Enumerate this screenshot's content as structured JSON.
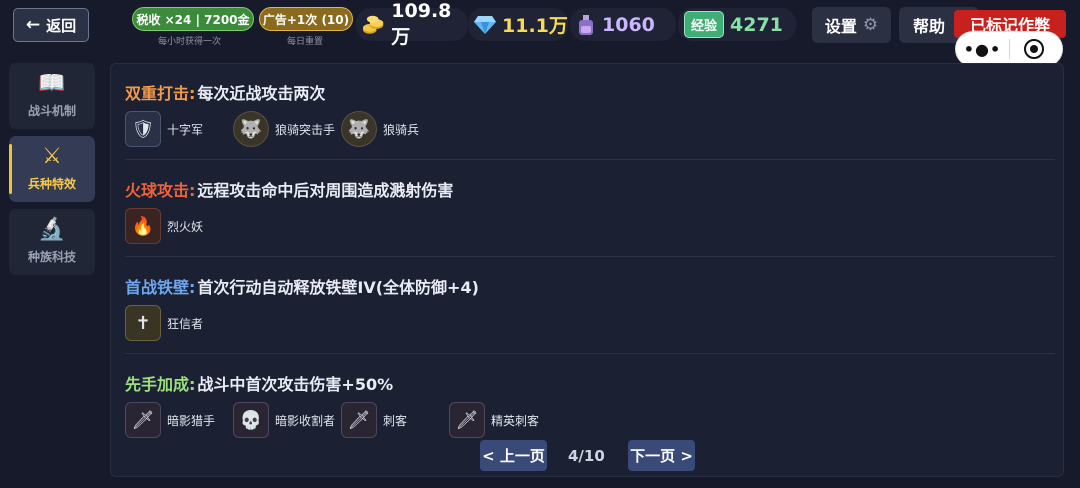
{
  "topbar": {
    "back_label": "返回",
    "tax_pill": "税收 ×24 | 7200金",
    "tax_note": "每小时获得一次",
    "ad_pill": "广告+1次 (10)",
    "ad_note": "每日重置",
    "gold": "109.8万",
    "gems": "11.1万",
    "potion": "1060",
    "exp_label": "经验",
    "exp_value": "4271",
    "settings_label": "设置",
    "help_label": "帮助",
    "marked_badge": "已标记作弊"
  },
  "sidebar": {
    "items": [
      {
        "label": "战斗机制",
        "icon": "book-icon"
      },
      {
        "label": "兵种特效",
        "icon": "crossed-swords-icon",
        "active": true
      },
      {
        "label": "种族科技",
        "icon": "microscope-icon"
      }
    ]
  },
  "sections": [
    {
      "title": "双重打击:",
      "title_color": "#f29a4a",
      "desc": "每次近战攻击两次",
      "units": [
        {
          "name": "十字军",
          "icon": "crusader-portrait"
        },
        {
          "name": "狼骑突击手",
          "icon": "wolf-rider-raider-portrait"
        },
        {
          "name": "狼骑兵",
          "icon": "wolf-rider-portrait"
        }
      ]
    },
    {
      "title": "火球攻击:",
      "title_color": "#f0623d",
      "desc": "远程攻击命中后对周围造成溅射伤害",
      "units": [
        {
          "name": "烈火妖",
          "icon": "fire-demon-portrait"
        }
      ]
    },
    {
      "title": "首战铁壁:",
      "title_color": "#6ea7ef",
      "desc": "首次行动自动释放铁壁IV(全体防御+4)",
      "units": [
        {
          "name": "狂信者",
          "icon": "zealot-portrait"
        }
      ]
    },
    {
      "title": "先手加成:",
      "title_color": "#9be07f",
      "desc": "战斗中首次攻击伤害+50%",
      "units": [
        {
          "name": "暗影猎手",
          "icon": "shadow-hunter-portrait"
        },
        {
          "name": "暗影收割者",
          "icon": "shadow-reaper-portrait"
        },
        {
          "name": "刺客",
          "icon": "assassin-portrait"
        },
        {
          "name": "精英刺客",
          "icon": "elite-assassin-portrait"
        }
      ]
    }
  ],
  "pager": {
    "prev_label": "< 上一页",
    "next_label": "下一页 >",
    "page": "4/10"
  },
  "colors": {
    "background": "#161a2b",
    "accent_gold": "#f2c232",
    "badge_red": "#c7201d"
  }
}
